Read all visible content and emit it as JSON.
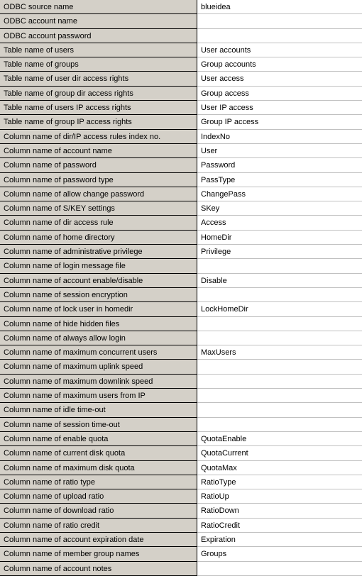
{
  "rows": [
    {
      "label": "ODBC source name",
      "value": "blueidea"
    },
    {
      "label": "ODBC account name",
      "value": ""
    },
    {
      "label": "ODBC account password",
      "value": ""
    },
    {
      "label": "Table name of users",
      "value": "User accounts"
    },
    {
      "label": "Table name of groups",
      "value": "Group accounts"
    },
    {
      "label": "Table name of user dir access rights",
      "value": "User access"
    },
    {
      "label": "Table name of group dir access rights",
      "value": "Group access"
    },
    {
      "label": "Table name of users IP access rights",
      "value": "User IP access"
    },
    {
      "label": "Table name of group IP access rights",
      "value": "Group IP access"
    },
    {
      "label": "Column name of dir/IP access rules index no.",
      "value": "IndexNo"
    },
    {
      "label": "Column name of account name",
      "value": "User"
    },
    {
      "label": "Column name of password",
      "value": "Password"
    },
    {
      "label": "Column name of password type",
      "value": "PassType"
    },
    {
      "label": "Column name of allow change password",
      "value": "ChangePass"
    },
    {
      "label": "Column name of S/KEY settings",
      "value": "SKey"
    },
    {
      "label": "Column name of dir access rule",
      "value": "Access"
    },
    {
      "label": "Column name of home directory",
      "value": "HomeDir"
    },
    {
      "label": "Column name of administrative privilege",
      "value": "Privilege"
    },
    {
      "label": "Column name of login message file",
      "value": ""
    },
    {
      "label": "Column name of account enable/disable",
      "value": "Disable"
    },
    {
      "label": "Column name of session encryption",
      "value": ""
    },
    {
      "label": "Column name of lock user in homedir",
      "value": "LockHomeDir"
    },
    {
      "label": "Column name of hide hidden files",
      "value": ""
    },
    {
      "label": "Column name of always allow login",
      "value": ""
    },
    {
      "label": "Column name of maximum concurrent users",
      "value": "MaxUsers"
    },
    {
      "label": "Column name of maximum uplink speed",
      "value": ""
    },
    {
      "label": "Column name of maximum downlink speed",
      "value": ""
    },
    {
      "label": "Column name of maximum users from IP",
      "value": ""
    },
    {
      "label": "Column name of idle time-out",
      "value": ""
    },
    {
      "label": "Column name of session time-out",
      "value": ""
    },
    {
      "label": "Column name of enable quota",
      "value": "QuotaEnable"
    },
    {
      "label": "Column name of current disk quota",
      "value": "QuotaCurrent"
    },
    {
      "label": "Column name of maximum disk quota",
      "value": "QuotaMax"
    },
    {
      "label": "Column name of ratio type",
      "value": "RatioType"
    },
    {
      "label": "Column name of upload ratio",
      "value": "RatioUp"
    },
    {
      "label": "Column name of download ratio",
      "value": "RatioDown"
    },
    {
      "label": "Column name of ratio credit",
      "value": "RatioCredit"
    },
    {
      "label": "Column name of account expiration date",
      "value": "Expiration"
    },
    {
      "label": "Column name of member group names",
      "value": "Groups"
    },
    {
      "label": "Column name of account notes",
      "value": ""
    }
  ]
}
